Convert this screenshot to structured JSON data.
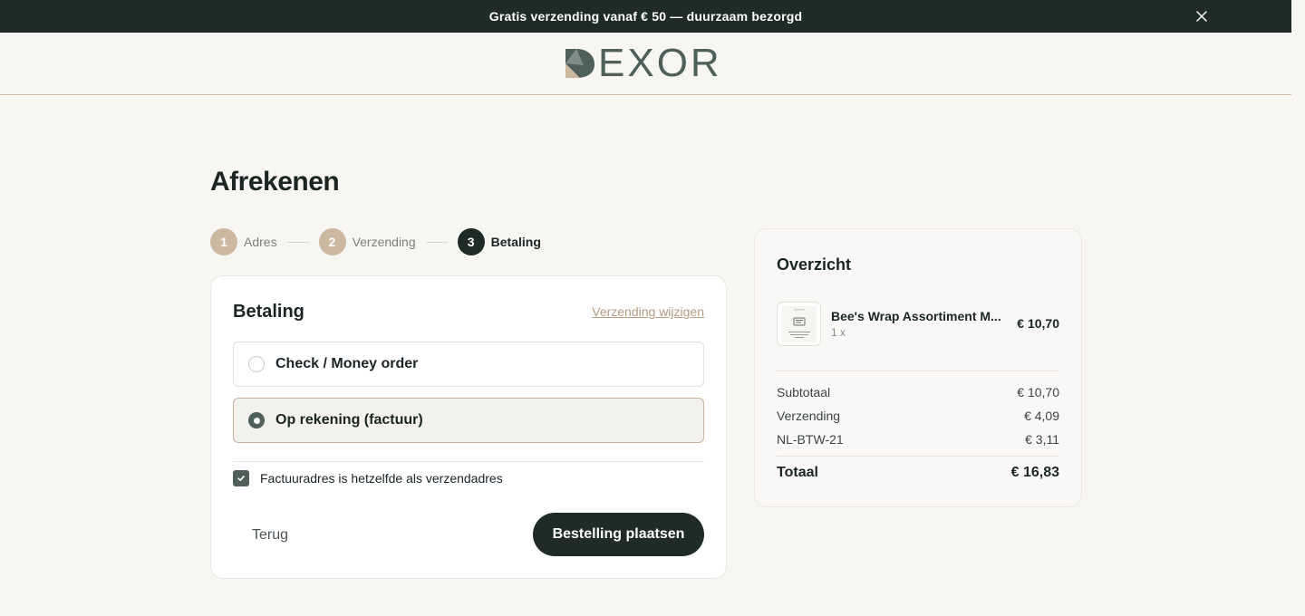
{
  "announcement": {
    "text": "Gratis verzending vanaf € 50 — duurzaam bezorgd",
    "close_icon": "close-icon"
  },
  "header": {
    "logo_text": "EXOR",
    "logo_icon": "dexor-logo-mark"
  },
  "page": {
    "title": "Afrekenen"
  },
  "steps": [
    {
      "number": "1",
      "label": "Adres",
      "state": "done"
    },
    {
      "number": "2",
      "label": "Verzending",
      "state": "done"
    },
    {
      "number": "3",
      "label": "Betaling",
      "state": "active"
    }
  ],
  "payment": {
    "title": "Betaling",
    "change_link": "Verzending wijzigen",
    "options": [
      {
        "label": "Check / Money order",
        "selected": false
      },
      {
        "label": "Op rekening (factuur)",
        "selected": true
      }
    ],
    "billing_same_label": "Factuuradres is hetzelfde als verzendadres",
    "billing_same_checked": true,
    "back_label": "Terug",
    "submit_label": "Bestelling plaatsen"
  },
  "summary": {
    "title": "Overzicht",
    "item": {
      "name": "Bee's Wrap Assortiment M...",
      "qty": "1 x",
      "price": "€ 10,70"
    },
    "rows": [
      {
        "label": "Subtotaal",
        "value": "€ 10,70"
      },
      {
        "label": "Verzending",
        "value": "€ 4,09"
      },
      {
        "label": "NL-BTW-21",
        "value": "€ 3,11"
      }
    ],
    "total_label": "Totaal",
    "total_value": "€ 16,83"
  },
  "colors": {
    "dark": "#1e2b27",
    "accent": "#cdb8a1",
    "brand": "#4f5f59",
    "link": "#b79b82"
  }
}
